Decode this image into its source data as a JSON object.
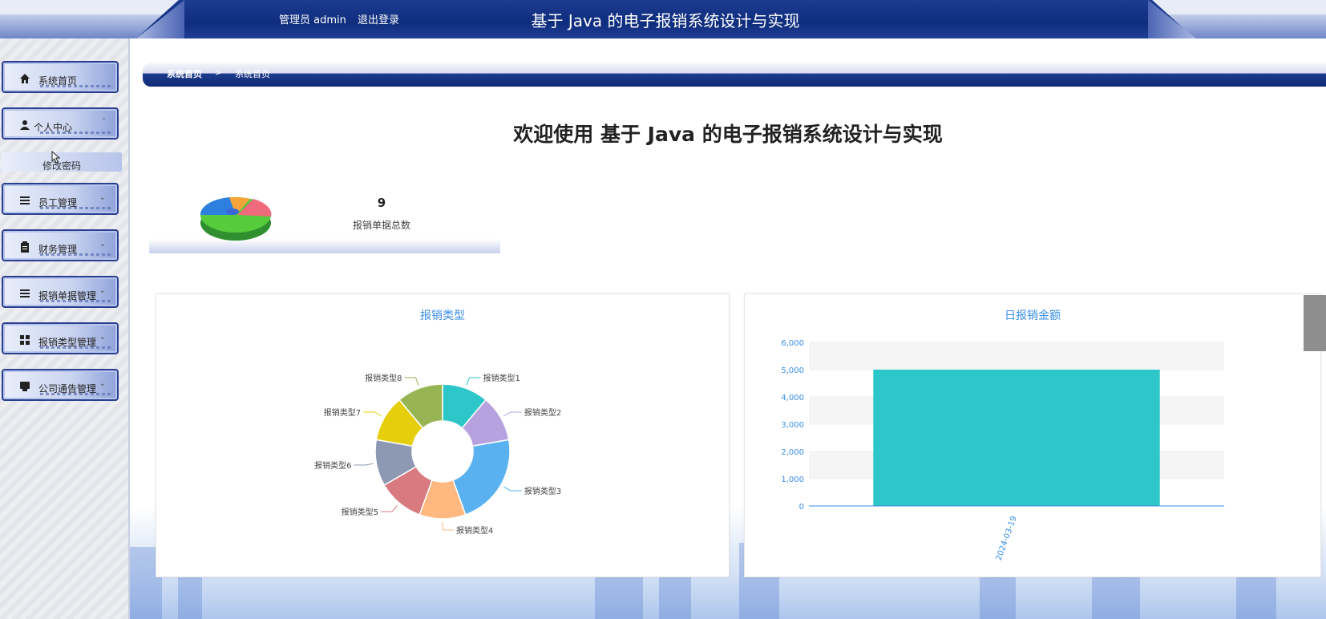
{
  "header": {
    "user_role": "管理员 admin",
    "logout_label": "退出登录",
    "system_title": "基于 Java 的电子报销系统设计与实现"
  },
  "sidebar": {
    "items": [
      {
        "label": "系统首页",
        "icon": "home-icon"
      },
      {
        "label": "个人中心",
        "icon": "user-icon"
      },
      {
        "label": "员工管理",
        "icon": "list-icon"
      },
      {
        "label": "财务管理",
        "icon": "clipboard-icon"
      },
      {
        "label": "报销单据管理",
        "icon": "list-icon"
      },
      {
        "label": "报销类型管理",
        "icon": "grid-icon"
      },
      {
        "label": "公司通告管理",
        "icon": "notice-icon"
      }
    ],
    "submenu": {
      "label": "修改密码"
    }
  },
  "breadcrumb": {
    "root": "系统首页",
    "separator": ">",
    "current": "系统首页"
  },
  "welcome": "欢迎使用 基于 Java 的电子报销系统设计与实现",
  "stat": {
    "value": "9",
    "label": "报销单据总数"
  },
  "colors": {
    "header_blue": "#0f2d7d",
    "accent_title": "#3a8ee6",
    "bar_teal": "#2ec7c9"
  },
  "chart_data": [
    {
      "type": "pie",
      "title": "报销类型",
      "categories": [
        "报销类型1",
        "报销类型2",
        "报销类型3",
        "报销类型4",
        "报销类型5",
        "报销类型6",
        "报销类型7",
        "报销类型8"
      ],
      "values": [
        1,
        1,
        2,
        1,
        1,
        1,
        1,
        1
      ],
      "colors": [
        "#2ec7c9",
        "#b6a2de",
        "#5ab1ef",
        "#ffb980",
        "#d87a80",
        "#8d98b3",
        "#e5cf0d",
        "#97b552"
      ],
      "donut": true
    },
    {
      "type": "bar",
      "title": "日报销金额",
      "categories": [
        "2024-03-19"
      ],
      "values": [
        5000
      ],
      "ylim": [
        0,
        6000
      ],
      "yticks": [
        "0",
        "1,000",
        "2,000",
        "3,000",
        "4,000",
        "5,000",
        "6,000"
      ],
      "grid": true
    }
  ]
}
